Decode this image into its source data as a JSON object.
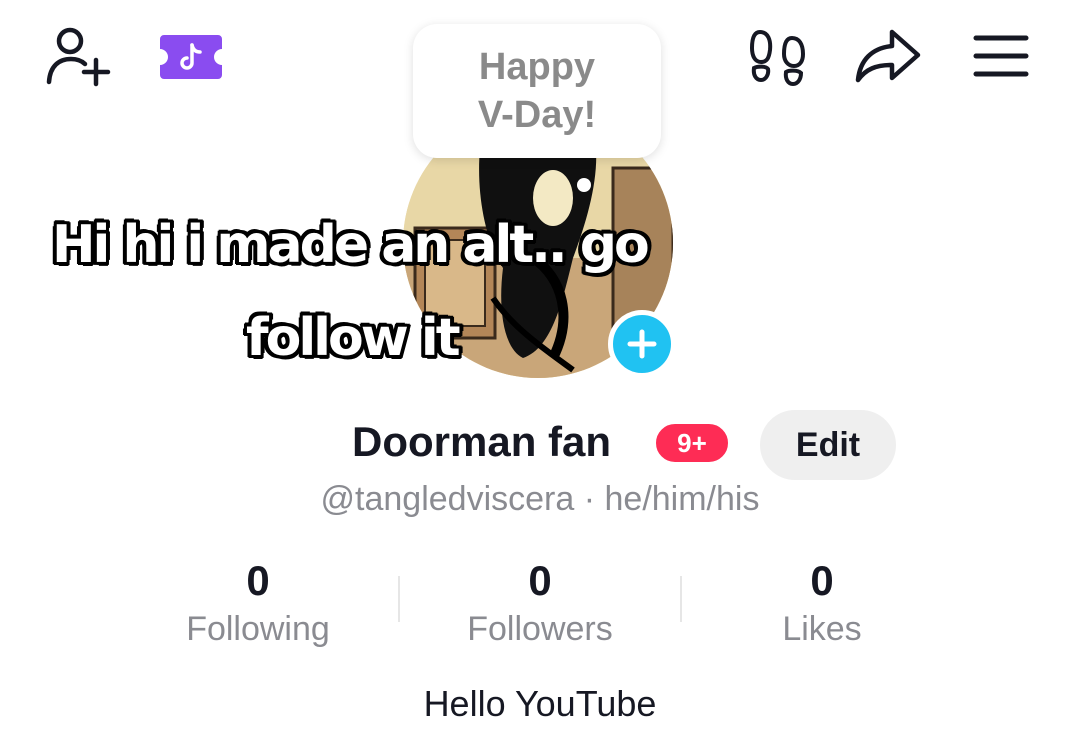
{
  "note": {
    "line1": "Happy",
    "line2": "V-Day!"
  },
  "caption": {
    "line1": "Hi hi i made an alt.. go",
    "line2": "follow it"
  },
  "profile": {
    "display_name": "Doorman fan",
    "notification_badge": "9+",
    "edit_label": "Edit",
    "username_line": "@tangledviscera · he/him/his",
    "bio": "Hello YouTube"
  },
  "stats": [
    {
      "value": "0",
      "label": "Following"
    },
    {
      "value": "0",
      "label": "Followers"
    },
    {
      "value": "0",
      "label": "Likes"
    }
  ],
  "icons": {
    "add_friend": "add-friend-icon",
    "ticket": "tiktok-ticket-icon",
    "footprints": "profile-views-footprints-icon",
    "share": "share-arrow-icon",
    "menu": "hamburger-menu-icon",
    "plus": "plus-icon"
  },
  "colors": {
    "ticket_purple": "#8a4cf0",
    "plus_badge_blue": "#20c2f2",
    "notification_red": "#fe2c55",
    "edit_button_bg": "#efefef",
    "secondary_text": "#8a8b91"
  }
}
